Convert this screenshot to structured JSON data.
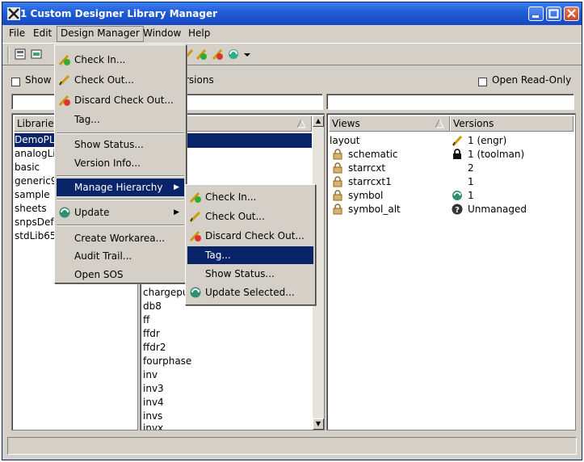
{
  "window": {
    "title": "1 Custom Designer Library Manager"
  },
  "menubar": {
    "items": [
      "File",
      "Edit",
      "Design Manager",
      "Window",
      "Help"
    ]
  },
  "options": {
    "show_prefix": "Show",
    "show_suffix": "rsions",
    "open_read_only": "Open Read-Only"
  },
  "libraries": {
    "header": "Libraries",
    "items": [
      "DemoPL",
      "analogLi",
      "basic",
      "generic9",
      "sample",
      "sheets",
      "snpsDef",
      "stdLib65"
    ]
  },
  "cells": {
    "items": [
      "chargepu",
      "db8",
      "ff",
      "ffdr",
      "ffdr2",
      "fourphase",
      "inv",
      "inv3",
      "inv4",
      "invs",
      "invx"
    ]
  },
  "views": {
    "header_views": "Views",
    "header_versions": "Versions",
    "rows": [
      {
        "name": "layout",
        "version": "1 (engr)",
        "icon": "checkout-pen-icon"
      },
      {
        "name": "schematic",
        "version": "1 (toolman)",
        "icon": "locked-icon"
      },
      {
        "name": "starrcxt",
        "version": "2",
        "icon": ""
      },
      {
        "name": "starrcxt1",
        "version": "1",
        "icon": ""
      },
      {
        "name": "symbol",
        "version": "1",
        "icon": "update-icon"
      },
      {
        "name": "symbol_alt",
        "version": "Unmanaged",
        "icon": "unmanaged-icon"
      }
    ]
  },
  "dm_menu": {
    "items": [
      "Check In...",
      "Check Out...",
      "Discard Check Out...",
      "Tag...",
      "Show Status...",
      "Version Info...",
      "Manage Hierarchy",
      "Update",
      "Create Workarea...",
      "Audit Trail...",
      "Open SOS"
    ]
  },
  "submenu": {
    "items": [
      "Check In...",
      "Check Out...",
      "Discard Check Out...",
      "Tag...",
      "Show Status...",
      "Update Selected..."
    ]
  },
  "colors": {
    "title_blue": "#1f5bd6",
    "selection": "#0a246a",
    "menu_bg": "#d4d0c8"
  }
}
